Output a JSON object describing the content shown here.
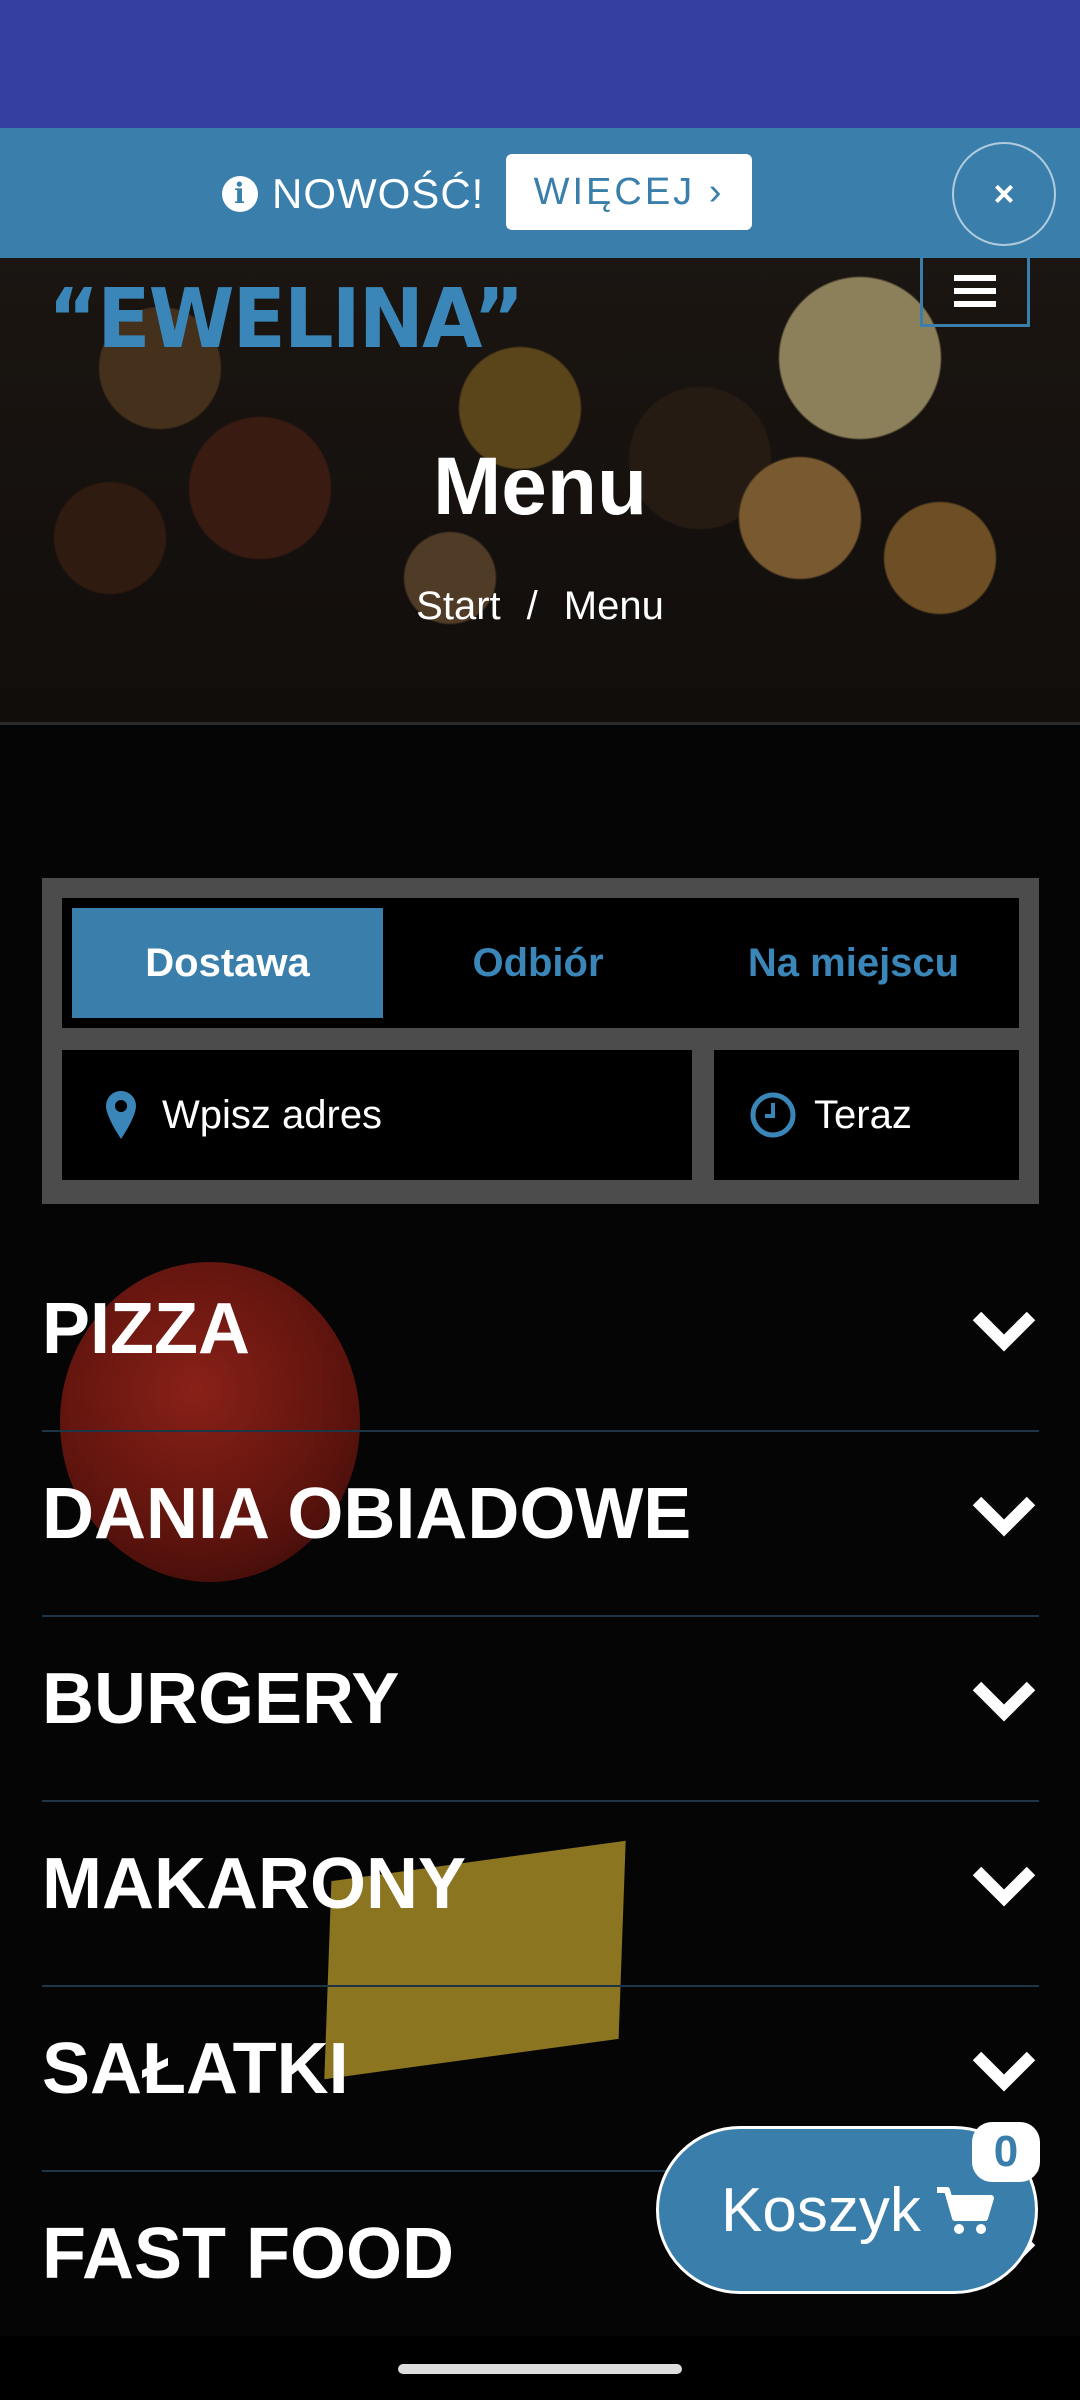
{
  "promo": {
    "text": "NOWOŚĆ!",
    "button": "WIĘCEJ ›",
    "close": "×"
  },
  "brand": {
    "logo_text": "“EWELINA”"
  },
  "hero": {
    "title": "Menu",
    "breadcrumb": [
      "Start",
      "/",
      "Menu"
    ]
  },
  "order": {
    "tabs": [
      {
        "label": "Dostawa",
        "active": true
      },
      {
        "label": "Odbiór",
        "active": false
      },
      {
        "label": "Na miejscu",
        "active": false
      }
    ],
    "address_placeholder": "Wpisz adres",
    "time_value": "Teraz"
  },
  "categories": [
    "PIZZA",
    "DANIA OBIADOWE",
    "BURGERY",
    "MAKARONY",
    "SAŁATKI",
    "FAST FOOD"
  ],
  "cart": {
    "label": "Koszyk",
    "count": "0"
  },
  "colors": {
    "accent": "#3a7fab",
    "status_bar": "#3340a1",
    "background": "#050505"
  }
}
